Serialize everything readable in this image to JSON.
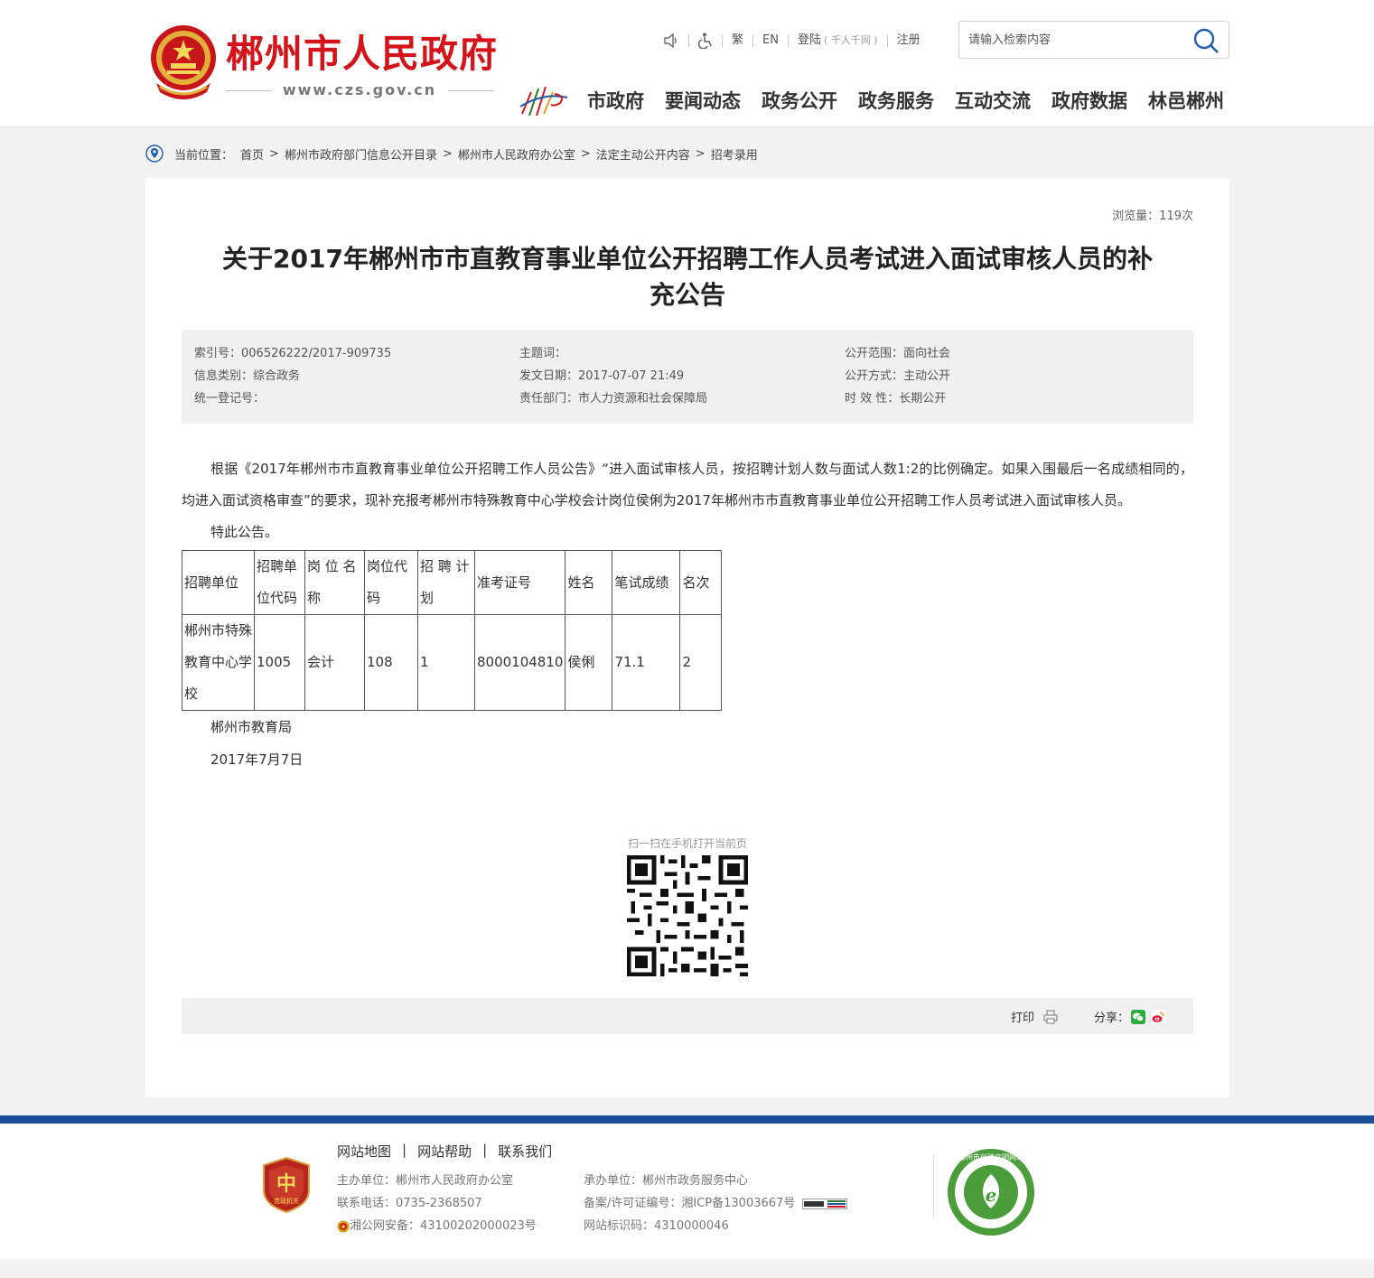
{
  "header": {
    "site_title": "郴州市人民政府",
    "site_url": "www.czs.gov.cn",
    "toplinks": {
      "traditional": "繁",
      "english": "EN",
      "login": "登陆",
      "login_sub": "( 千人千网 )",
      "register": "注册"
    },
    "search_placeholder": "请输入检索内容",
    "nav": [
      "市政府",
      "要闻动态",
      "政务公开",
      "政务服务",
      "互动交流",
      "政府数据",
      "林邑郴州"
    ]
  },
  "breadcrumb": {
    "label": "当前位置：",
    "items": [
      "首页",
      "郴州市政府部门信息公开目录",
      "郴州市人民政府办公室",
      "法定主动公开内容",
      "招考录用"
    ]
  },
  "article": {
    "views": "浏览量：119次",
    "title_line1": "关于2017年郴州市市直教育事业单位公开招聘工作人员考试进入面试审核人员的补",
    "title_line2": "充公告",
    "meta": {
      "index_no": "索引号：006526222/2017-909735",
      "category": "信息类别：综合政务",
      "reg_no": "统一登记号：",
      "keywords": "主题词：",
      "publish_date": "发文日期：2017-07-07 21:49",
      "department": "责任部门：市人力资源和社会保障局",
      "scope": "公开范围：面向社会",
      "method": "公开方式：主动公开",
      "validity": "时 效 性：长期公开"
    },
    "body_para": "根据《2017年郴州市市直教育事业单位公开招聘工作人员公告》“进入面试审核人员，按招聘计划人数与面试人数1:2的比例确定。如果入围最后一名成绩相同的，均进入面试资格审查”的要求，现补充报考郴州市特殊教育中心学校会计岗位侯俐为2017年郴州市市直教育事业单位公开招聘工作人员考试进入面试审核人员。",
    "notice": "特此公告。",
    "table": {
      "headers": [
        "招聘单位",
        "招聘单位代码",
        "岗 位 名称",
        "岗位代码",
        "招 聘 计划",
        "准考证号",
        "姓名",
        "笔试成绩",
        "名次"
      ],
      "rows": [
        [
          "郴州市特殊教育中心学校",
          "1005",
          "会计",
          "108",
          "1",
          "8000104810",
          "侯俐",
          "71.1",
          "2"
        ]
      ]
    },
    "signer": "郴州市教育局",
    "sign_date": "2017年7月7日",
    "qr_caption": "扫一扫在手机打开当前页",
    "print": "打印",
    "share": "分享："
  },
  "footer": {
    "links": [
      "网站地图",
      "网站帮助",
      "联系我们"
    ],
    "sep": "|",
    "sponsor": "主办单位：郴州市人民政府办公室",
    "phone": "联系电话：0735-2368507",
    "police": "湘公网安备：43100202000023号",
    "operator": "承办单位：郴州市政务服务中心",
    "icp": "备案/许可证编号：湘ICP备13003667号",
    "site_id": "网站标识码：4310000046",
    "badge_text": "党政机关",
    "civil_text": "郴州市创建文明网站"
  },
  "colors": {
    "brand_red": "#d4141a",
    "footer_blue": "#1d4f9c",
    "meta_bg": "#f0f0f0"
  }
}
